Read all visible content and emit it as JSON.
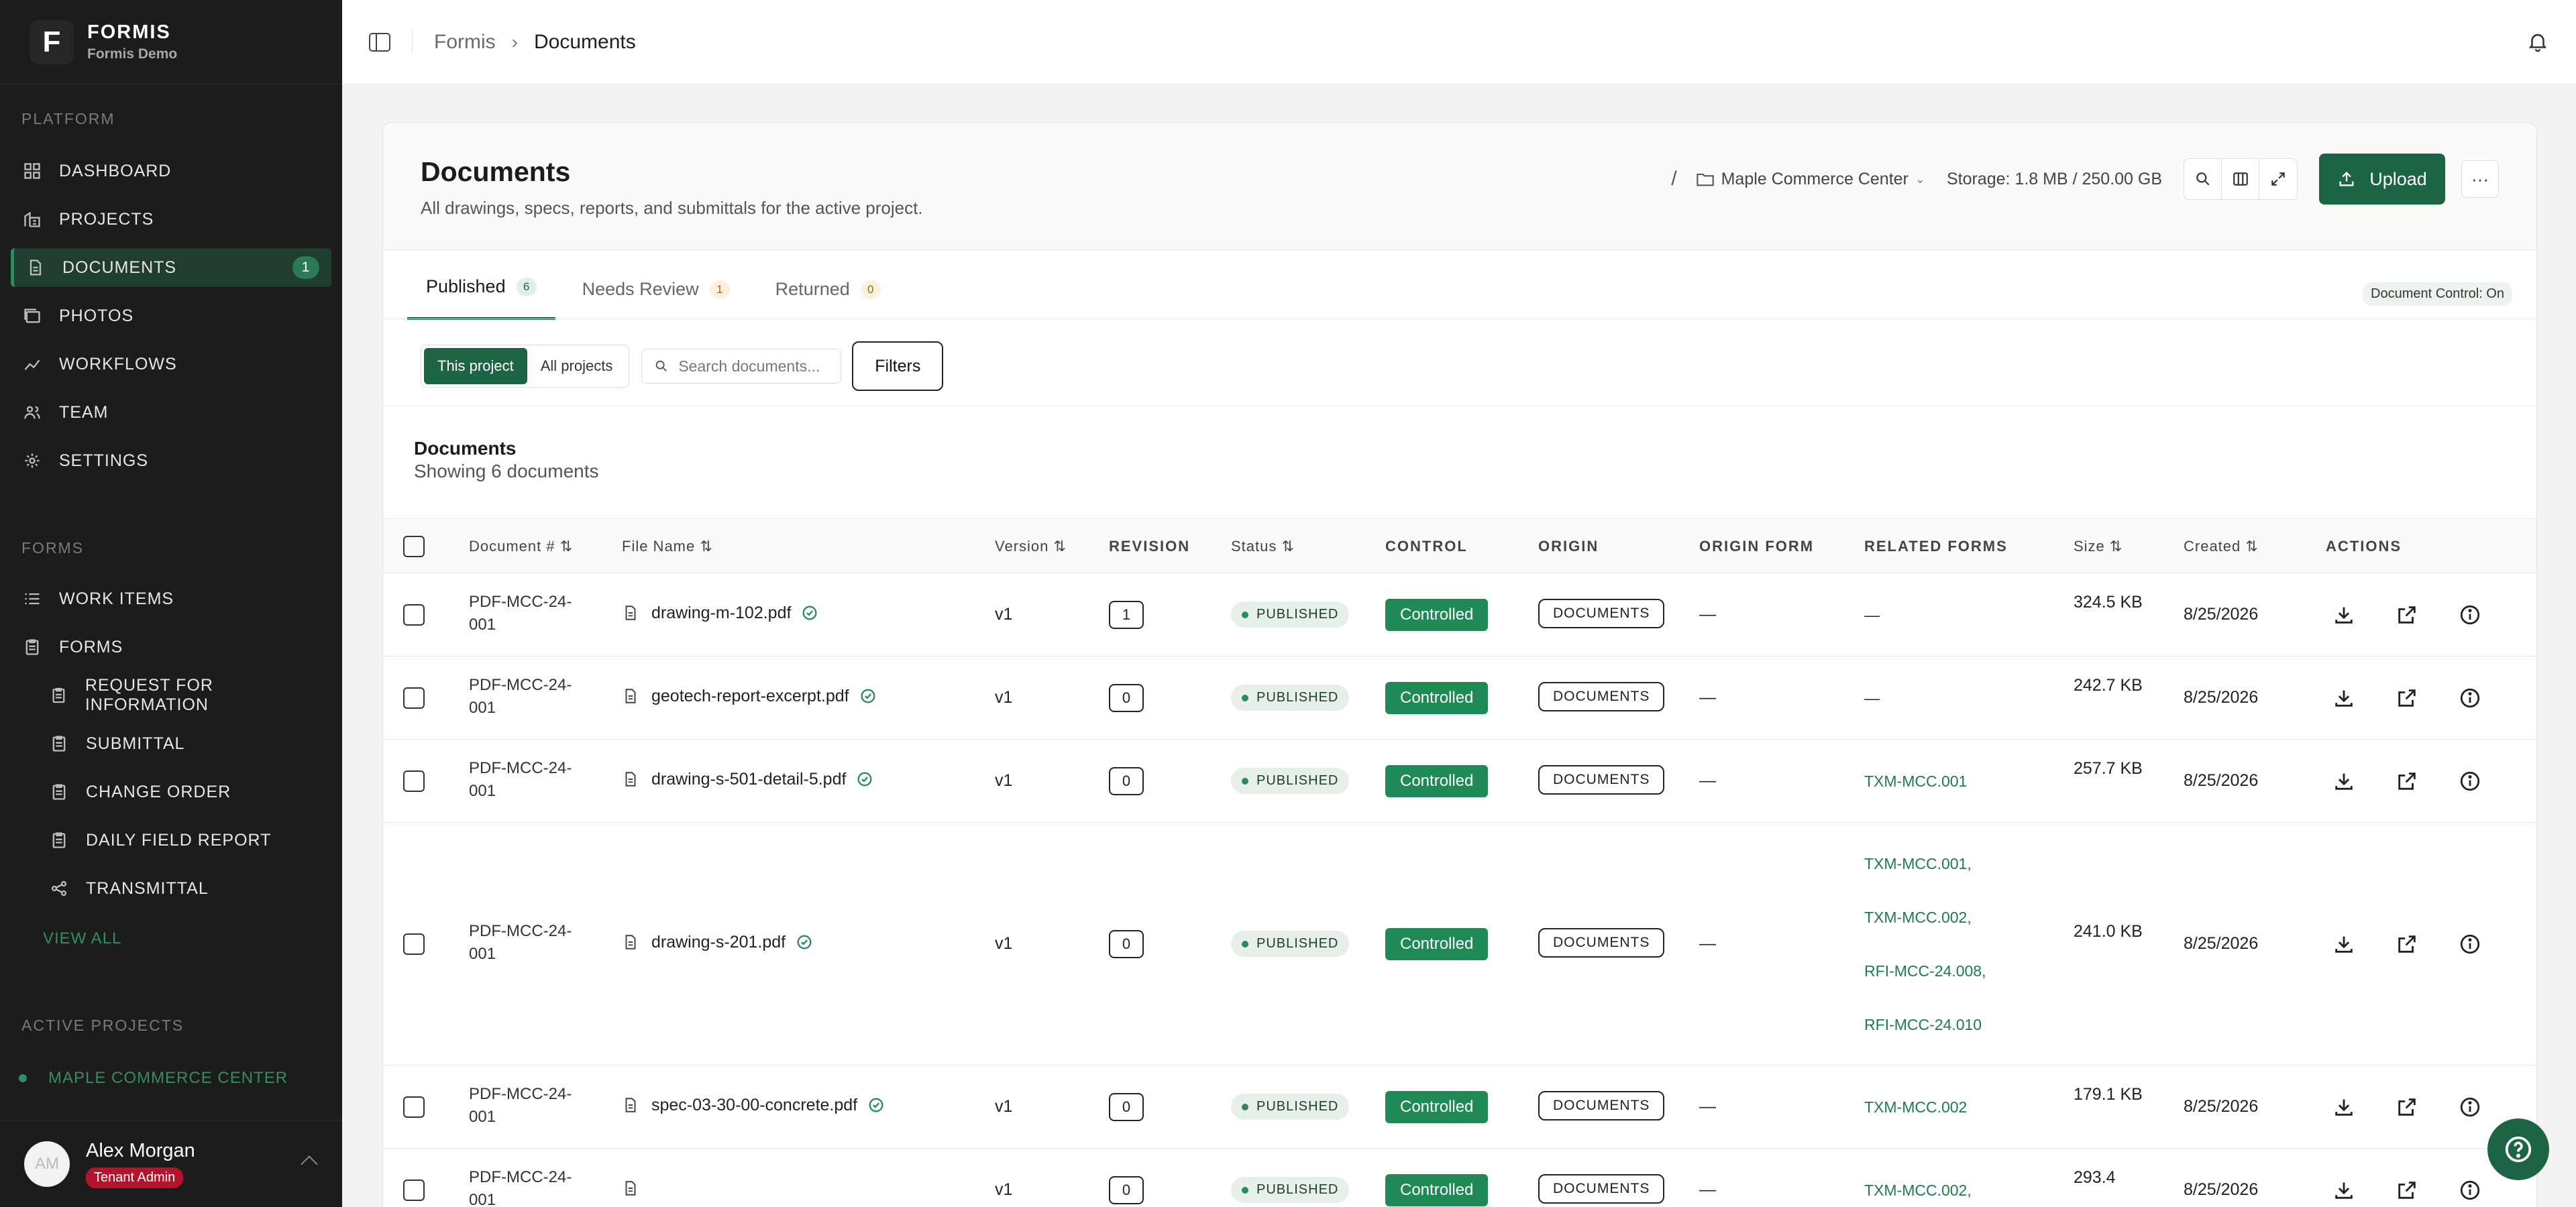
{
  "brand": {
    "name": "FORMIS",
    "subtitle": "Formis Demo",
    "logo_letter": "F"
  },
  "sidebar": {
    "platform_label": "PLATFORM",
    "platform_items": [
      {
        "label": "DASHBOARD",
        "icon": "grid-icon"
      },
      {
        "label": "PROJECTS",
        "icon": "building-icon"
      },
      {
        "label": "DOCUMENTS",
        "icon": "document-icon",
        "count": "1",
        "active": true
      },
      {
        "label": "PHOTOS",
        "icon": "photos-icon"
      },
      {
        "label": "WORKFLOWS",
        "icon": "workflow-icon"
      },
      {
        "label": "TEAM",
        "icon": "team-icon"
      },
      {
        "label": "SETTINGS",
        "icon": "gear-icon"
      }
    ],
    "forms_label": "FORMS",
    "forms_items": [
      {
        "label": "WORK ITEMS",
        "icon": "list-icon"
      },
      {
        "label": "FORMS",
        "icon": "clipboard-icon"
      }
    ],
    "forms_sub": [
      {
        "label": "REQUEST FOR INFORMATION"
      },
      {
        "label": "SUBMITTAL"
      },
      {
        "label": "CHANGE ORDER"
      },
      {
        "label": "DAILY FIELD REPORT"
      },
      {
        "label": "TRANSMITTAL"
      }
    ],
    "view_all": "VIEW ALL",
    "active_projects_label": "ACTIVE PROJECTS",
    "active_project": "MAPLE COMMERCE CENTER"
  },
  "user": {
    "initials": "AM",
    "name": "Alex Morgan",
    "role": "Tenant Admin"
  },
  "breadcrumb": {
    "root": "Formis",
    "current": "Documents"
  },
  "header": {
    "title": "Documents",
    "description": "All drawings, specs, reports, and submittals for the active project.",
    "separator": "/",
    "project": "Maple Commerce Center",
    "storage": "Storage: 1.8 MB / 250.00 GB",
    "upload": "Upload",
    "more": "···"
  },
  "tabs": [
    {
      "label": "Published",
      "count": "6",
      "active": true,
      "badge_color": "#e3efe6",
      "badge_text": "#1d6445"
    },
    {
      "label": "Needs Review",
      "count": "1",
      "badge_color": "#fdf0de",
      "badge_text": "#9a6a1c"
    },
    {
      "label": "Returned",
      "count": "0",
      "badge_color": "#fdf0de",
      "badge_text": "#9a6a1c"
    }
  ],
  "document_control": "Document Control: On",
  "filters": {
    "this_project": "This project",
    "all_projects": "All projects",
    "search_placeholder": "Search documents...",
    "filters_label": "Filters"
  },
  "list": {
    "title": "Documents",
    "subtitle": "Showing 6 documents"
  },
  "columns": {
    "doc_no": "Document #",
    "file_name": "File Name",
    "version": "Version",
    "revision": "REVISION",
    "status": "Status",
    "control": "CONTROL",
    "origin": "ORIGIN",
    "origin_form": "ORIGIN FORM",
    "related": "RELATED FORMS",
    "size": "Size",
    "created": "Created",
    "actions": "ACTIONS"
  },
  "rows": [
    {
      "doc_a": "PDF-MCC-24-",
      "doc_b": "001",
      "file": "drawing-m-102.pdf",
      "version": "v1",
      "revision": "1",
      "status": "PUBLISHED",
      "control": "Controlled",
      "origin": "DOCUMENTS",
      "origin_form": "—",
      "related": [
        "—"
      ],
      "size": "324.5 KB",
      "created": "8/25/2026"
    },
    {
      "doc_a": "PDF-MCC-24-",
      "doc_b": "001",
      "file": "geotech-report-excerpt.pdf",
      "version": "v1",
      "revision": "0",
      "status": "PUBLISHED",
      "control": "Controlled",
      "origin": "DOCUMENTS",
      "origin_form": "—",
      "related": [
        "—"
      ],
      "size": "242.7 KB",
      "created": "8/25/2026"
    },
    {
      "doc_a": "PDF-MCC-24-",
      "doc_b": "001",
      "file": "drawing-s-501-detail-5.pdf",
      "version": "v1",
      "revision": "0",
      "status": "PUBLISHED",
      "control": "Controlled",
      "origin": "DOCUMENTS",
      "origin_form": "—",
      "related": [
        "TXM-MCC.001"
      ],
      "size": "257.7 KB",
      "created": "8/25/2026"
    },
    {
      "doc_a": "PDF-MCC-24-",
      "doc_b": "001",
      "file": "drawing-s-201.pdf",
      "version": "v1",
      "revision": "0",
      "status": "PUBLISHED",
      "control": "Controlled",
      "origin": "DOCUMENTS",
      "origin_form": "—",
      "related": [
        "TXM-MCC.001,",
        "TXM-MCC.002,",
        "RFI-MCC-24.008,",
        "RFI-MCC-24.010"
      ],
      "size": "241.0 KB",
      "created": "8/25/2026"
    },
    {
      "doc_a": "PDF-MCC-24-",
      "doc_b": "001",
      "file": "spec-03-30-00-concrete.pdf",
      "version": "v1",
      "revision": "0",
      "status": "PUBLISHED",
      "control": "Controlled",
      "origin": "DOCUMENTS",
      "origin_form": "—",
      "related": [
        "TXM-MCC.002"
      ],
      "size": "179.1 KB",
      "created": "8/25/2026"
    },
    {
      "doc_a": "PDF-MCC-24-",
      "doc_b": "001",
      "file": "",
      "version": "v1",
      "revision": "0",
      "status": "PUBLISHED",
      "control": "Controlled",
      "origin": "DOCUMENTS",
      "origin_form": "—",
      "related": [
        "TXM-MCC.002,"
      ],
      "size": "293.4",
      "created": "8/25/2026"
    }
  ],
  "colors": {
    "accent": "#1d6445",
    "link": "#1f7a4d",
    "sidebar": "#1c1c1c"
  }
}
